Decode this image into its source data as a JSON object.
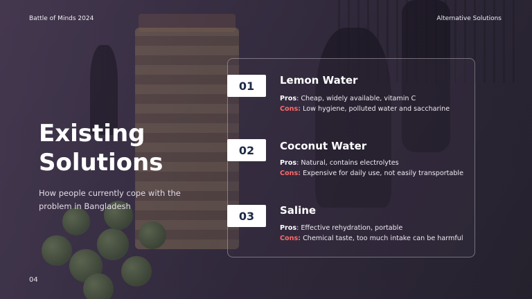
{
  "header": {
    "left": "Battle of Minds 2024",
    "right": "Alternative Solutions"
  },
  "footer": {
    "page_number": "04"
  },
  "main": {
    "title_line1": "Existing",
    "title_line2": "Solutions",
    "subtitle": "How people currently cope with the problem in Bangladesh"
  },
  "solutions": [
    {
      "number": "01",
      "title": "Lemon Water",
      "pros_label": "Pros",
      "pros": ": Cheap, widely available, vitamin C",
      "cons_label": "Cons:",
      "cons": " Low hygiene, polluted water and saccharine"
    },
    {
      "number": "02",
      "title": "Coconut Water",
      "pros_label": "Pros",
      "pros": ": Natural, contains electrolytes",
      "cons_label": "Cons:",
      "cons": " Expensive for daily use, not easily transportable"
    },
    {
      "number": "03",
      "title": "Saline",
      "pros_label": "Pros",
      "pros": ": Effective rehydration, portable",
      "cons_label": "Cons:",
      "cons": " Chemical taste, too much intake can be harmful"
    }
  ],
  "colors": {
    "cons_accent": "#ff6a6a",
    "number_text": "#1c2a45"
  }
}
